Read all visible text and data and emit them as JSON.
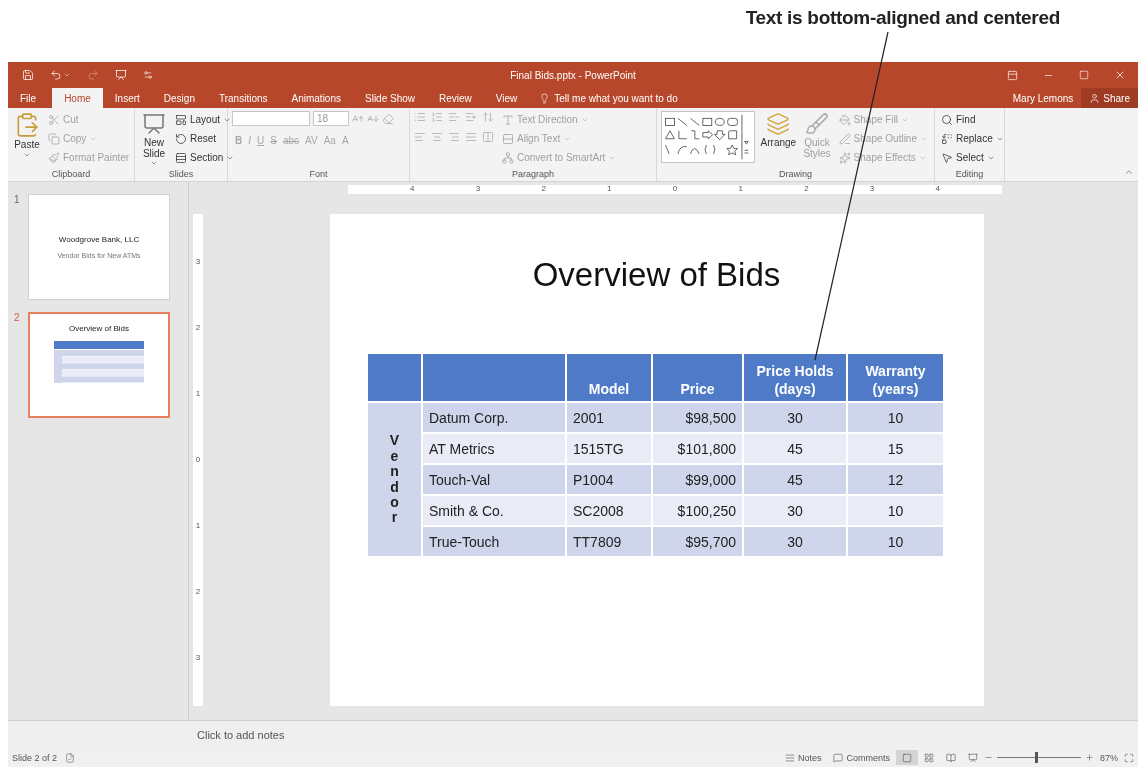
{
  "callout": {
    "text": "Text is bottom-aligned and centered"
  },
  "title_bar": {
    "title": "Final Bids.pptx - PowerPoint"
  },
  "tabs": [
    {
      "label": "File",
      "selected": false
    },
    {
      "label": "Home",
      "selected": true
    },
    {
      "label": "Insert",
      "selected": false
    },
    {
      "label": "Design",
      "selected": false
    },
    {
      "label": "Transitions",
      "selected": false
    },
    {
      "label": "Animations",
      "selected": false
    },
    {
      "label": "Slide Show",
      "selected": false
    },
    {
      "label": "Review",
      "selected": false
    },
    {
      "label": "View",
      "selected": false
    }
  ],
  "tell_me": {
    "placeholder": "Tell me what you want to do"
  },
  "account": {
    "user": "Mary Lemons",
    "share": "Share"
  },
  "ribbon": {
    "clipboard": {
      "label": "Clipboard",
      "paste": {
        "label": "Paste",
        "dropdown": true
      },
      "items": [
        {
          "label": "Cut",
          "disabled": true,
          "dropdown": false
        },
        {
          "label": "Copy",
          "disabled": true,
          "dropdown": true
        },
        {
          "label": "Format Painter",
          "disabled": true,
          "dropdown": false
        }
      ]
    },
    "slides": {
      "label": "Slides",
      "new_slide": {
        "label": "New Slide",
        "dropdown": true
      },
      "items": [
        {
          "label": "Layout",
          "disabled": false,
          "dropdown": true
        },
        {
          "label": "Reset",
          "disabled": false,
          "dropdown": false
        },
        {
          "label": "Section",
          "disabled": false,
          "dropdown": true
        }
      ]
    },
    "font": {
      "label": "Font",
      "size": "18",
      "disabled": true,
      "buttons": [
        "B",
        "I",
        "U",
        "S",
        "abc",
        "AV",
        "Aa",
        "A"
      ]
    },
    "paragraph": {
      "label": "Paragraph",
      "disabled": true,
      "items": [
        {
          "label": "Text Direction",
          "dropdown": true
        },
        {
          "label": "Align Text",
          "dropdown": true
        },
        {
          "label": "Convert to SmartArt",
          "dropdown": true
        }
      ]
    },
    "drawing": {
      "label": "Drawing",
      "arrange": {
        "label": "Arrange",
        "disabled": false
      },
      "quick_styles": {
        "label": "Quick Styles",
        "disabled": true
      },
      "items": [
        {
          "label": "Shape Fill",
          "disabled": true,
          "dropdown": true
        },
        {
          "label": "Shape Outline",
          "disabled": true,
          "dropdown": true
        },
        {
          "label": "Shape Effects",
          "disabled": true,
          "dropdown": true
        }
      ]
    },
    "editing": {
      "label": "Editing",
      "items": [
        {
          "label": "Find",
          "disabled": false,
          "dropdown": false
        },
        {
          "label": "Replace",
          "disabled": false,
          "dropdown": true
        },
        {
          "label": "Select",
          "disabled": false,
          "dropdown": true
        }
      ]
    }
  },
  "slides_pane": [
    {
      "number": "1",
      "selected": false,
      "kind": "title",
      "title": "Woodgrove Bank, LLC",
      "subtitle": "Vendor Bids for New ATMs"
    },
    {
      "number": "2",
      "selected": true,
      "kind": "table",
      "title": "Overview of Bids"
    }
  ],
  "h_ruler": [
    "4",
    "3",
    "2",
    "1",
    "0",
    "1",
    "2",
    "3",
    "4"
  ],
  "v_ruler": [
    "3",
    "2",
    "1",
    "0",
    "1",
    "2",
    "3"
  ],
  "slide": {
    "title": "Overview of Bids",
    "table": {
      "columns": [
        "",
        "Model",
        "Price",
        "Price Holds (days)",
        "Warranty (years)"
      ],
      "row_header": "Vendor",
      "rows": [
        {
          "cells": [
            "Datum Corp.",
            "2001",
            "$98,500",
            "30",
            "10"
          ]
        },
        {
          "cells": [
            "AT Metrics",
            "1515TG",
            "$101,800",
            "45",
            "15"
          ]
        },
        {
          "cells": [
            "Touch-Val",
            "P1004",
            "$99,000",
            "45",
            "12"
          ]
        },
        {
          "cells": [
            "Smith & Co.",
            "SC2008",
            "$100,250",
            "30",
            "10"
          ]
        },
        {
          "cells": [
            "True-Touch",
            "TT7809",
            "$95,700",
            "30",
            "10"
          ]
        }
      ]
    }
  },
  "notes": {
    "placeholder": "Click to add notes"
  },
  "status_bar": {
    "slide": "Slide 2 of 2",
    "notes": "Notes",
    "comments": "Comments",
    "views": [
      {
        "selected": true
      },
      {
        "selected": false
      },
      {
        "selected": false
      },
      {
        "selected": false
      }
    ],
    "zoom": {
      "level": 0.47,
      "reading": "87%"
    }
  }
}
